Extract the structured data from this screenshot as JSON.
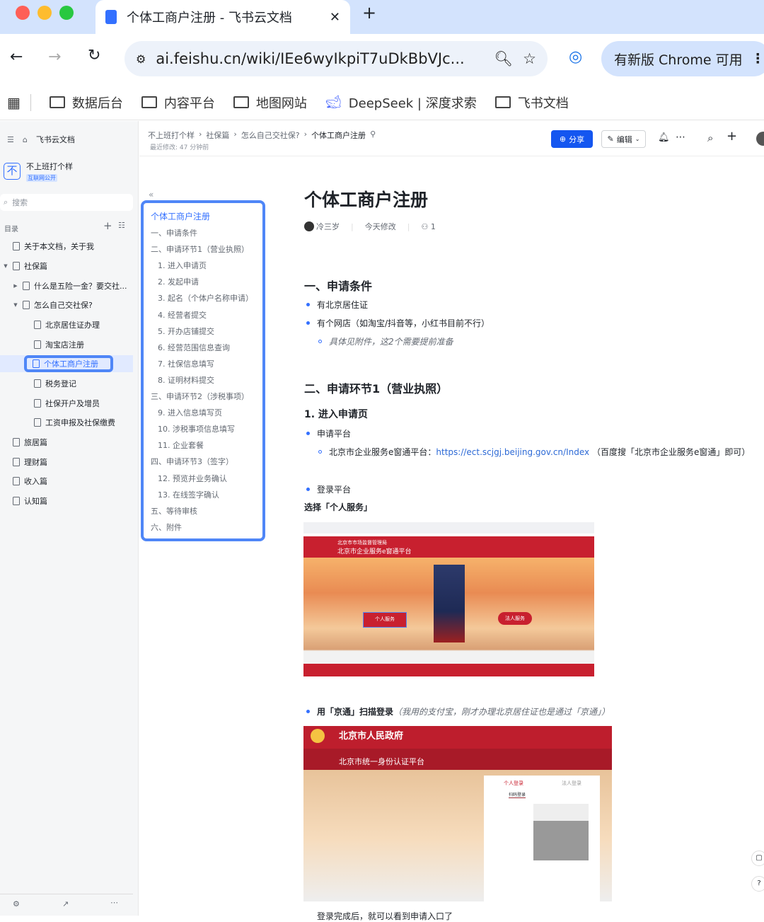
{
  "browser": {
    "tab_title": "个体工商户注册 - 飞书云文档",
    "url": "ai.feishu.cn/wiki/IEe6wyIkpiT7uDkBbVJc...",
    "update_label": "有新版 Chrome 可用",
    "bookmarks": [
      "数据后台",
      "内容平台",
      "地图网站",
      "DeepSeek | 深度求索",
      "飞书文档"
    ]
  },
  "sidebar": {
    "home": "飞书云文档",
    "space_name": "不上班打个样",
    "space_badge": "互联网公开",
    "space_logo": "不",
    "search_placeholder": "搜索",
    "toc_label": "目录",
    "items": [
      {
        "label": "关于本文档，关于我"
      },
      {
        "label": "社保篇"
      },
      {
        "label": "什么是五险一金？要交社..."
      },
      {
        "label": "怎么自己交社保?"
      },
      {
        "label": "北京居住证办理"
      },
      {
        "label": "淘宝店注册"
      },
      {
        "label": "个体工商户注册"
      },
      {
        "label": "税务登记"
      },
      {
        "label": "社保开户及增员"
      },
      {
        "label": "工资申报及社保缴费"
      },
      {
        "label": "旅居篇"
      },
      {
        "label": "理财篇"
      },
      {
        "label": "收入篇"
      },
      {
        "label": "认知篇"
      }
    ]
  },
  "header": {
    "breadcrumb": [
      "不上班打个样",
      "社保篇",
      "怎么自己交社保?",
      "个体工商户注册"
    ],
    "last_modified": "最近修改: 47 分钟前",
    "share": "分享",
    "edit": "编辑"
  },
  "toc": [
    "个体工商户注册",
    "一、申请条件",
    "二、申请环节1（营业执照）",
    "1. 进入申请页",
    "2. 发起申请",
    "3. 起名（个体户名称申请）",
    "4. 经营者提交",
    "5. 开办店铺提交",
    "6. 经营范围信息查询",
    "7. 社保信息填写",
    "8. 证明材料提交",
    "三、申请环节2（涉税事项）",
    "9. 进入信息填写页",
    "10. 涉税事项信息填写",
    "11. 企业套餐",
    "四、申请环节3（签字）",
    "12. 预览并业务确认",
    "13. 在线签字确认",
    "五、等待审核",
    "六、附件"
  ],
  "doc": {
    "title": "个体工商户注册",
    "author": "冷三岁",
    "modified": "今天修改",
    "viewers": "1",
    "h_conditions": "一、申请条件",
    "cond1": "有北京居住证",
    "cond2": "有个网店（如淘宝/抖音等，小红书目前不行）",
    "cond_note": "具体见附件，这2个需要提前准备",
    "h_step1": "二、申请环节1（营业执照）",
    "h_enter": "1. 进入申请页",
    "platform": "申请平台",
    "platform_name": "北京市企业服务e窗通平台：",
    "platform_url": "https://ect.scjgj.beijing.gov.cn/Index",
    "platform_hint": "（百度搜「北京市企业服务e窗通」即可）",
    "login": "登录平台",
    "choose": "选择「个人服务」",
    "shot1": {
      "org": "北京市市场监督管理局",
      "name": "北京市企业服务e窗通平台",
      "personal": "个人服务",
      "corporate": "法人服务"
    },
    "scan_bold": "用「京通」扫描登录",
    "scan_note": "（我用的支付宝，刚才办理北京居住证也是通过「京通」）",
    "shot2": {
      "gov": "北京市人民政府",
      "platform": "北京市统一身份认证平台",
      "tab1": "个人登录",
      "tab2": "法人登录",
      "scan": "扫码登录"
    },
    "after": "登录完成后，就可以看到申请入口了"
  }
}
